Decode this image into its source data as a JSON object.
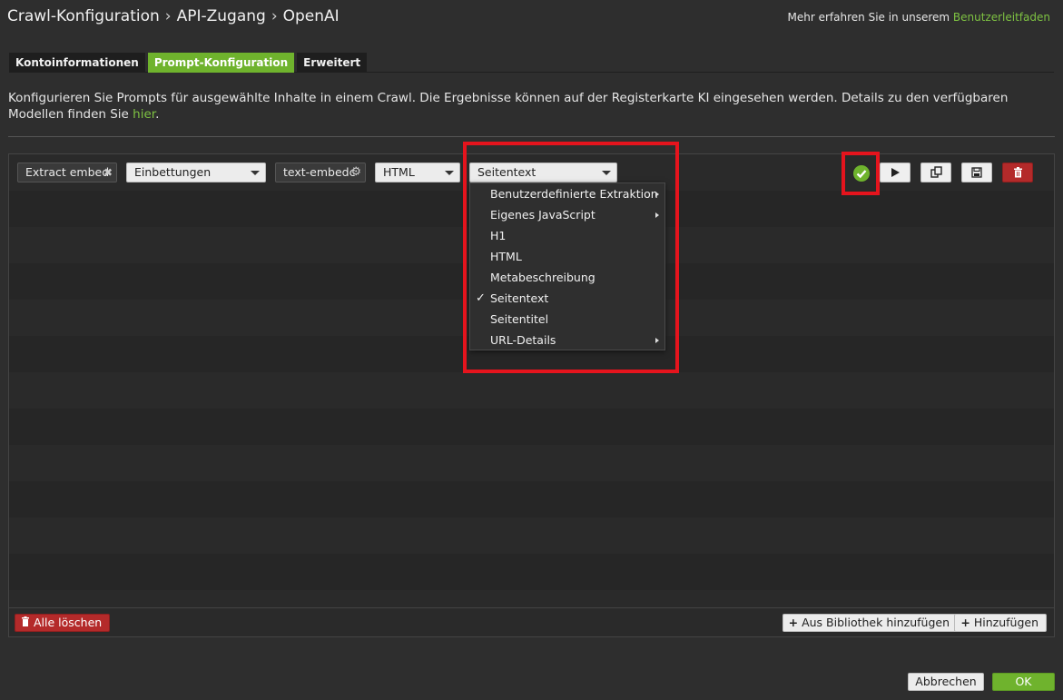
{
  "breadcrumb": [
    "Crawl-Konfiguration",
    "API-Zugang",
    "OpenAI"
  ],
  "breadcrumb_sep": "›",
  "help": {
    "prefix": "Mehr erfahren Sie in unserem",
    "link": "Benutzerleitfaden"
  },
  "tabs": [
    "Kontoinformationen",
    "Prompt-Konfiguration",
    "Erweitert"
  ],
  "description": {
    "text": "Konfigurieren Sie Prompts für ausgewählte Inhalte in einem Crawl. Die Ergebnisse können auf der Registerkarte KI eingesehen werden. Details zu den verfügbaren Modellen finden Sie ",
    "link": "hier",
    "suffix": "."
  },
  "prompt_row": {
    "name_value": "Extract embed",
    "type_value": "Einbettungen",
    "model_value": "text-embedc",
    "format_value": "HTML",
    "content_value": "Seitentext"
  },
  "content_menu": [
    {
      "label": "Benutzerdefinierte Extraktion",
      "submenu": true,
      "checked": false
    },
    {
      "label": "Eigenes JavaScript",
      "submenu": true,
      "checked": false
    },
    {
      "label": "H1",
      "submenu": false,
      "checked": false
    },
    {
      "label": "HTML",
      "submenu": false,
      "checked": false
    },
    {
      "label": "Metabeschreibung",
      "submenu": false,
      "checked": false
    },
    {
      "label": "Seitentext",
      "submenu": false,
      "checked": true
    },
    {
      "label": "Seitentitel",
      "submenu": false,
      "checked": false
    },
    {
      "label": "URL-Details",
      "submenu": true,
      "checked": false
    }
  ],
  "checkmark": "✓",
  "footer": {
    "clear_all": "Alle löschen",
    "from_library": "Aus Bibliothek hinzufügen",
    "add": "Hinzufügen"
  },
  "dialog": {
    "cancel": "Abbrechen",
    "ok": "OK"
  },
  "colors": {
    "accent": "#6fb32d",
    "danger": "#b42a2a",
    "highlight": "#e5141d"
  },
  "icons": [
    "close-icon",
    "gear-icon",
    "caret-down-icon",
    "check-circle-icon",
    "play-icon",
    "copy-icon",
    "save-icon",
    "trash-icon",
    "plus-icon"
  ]
}
